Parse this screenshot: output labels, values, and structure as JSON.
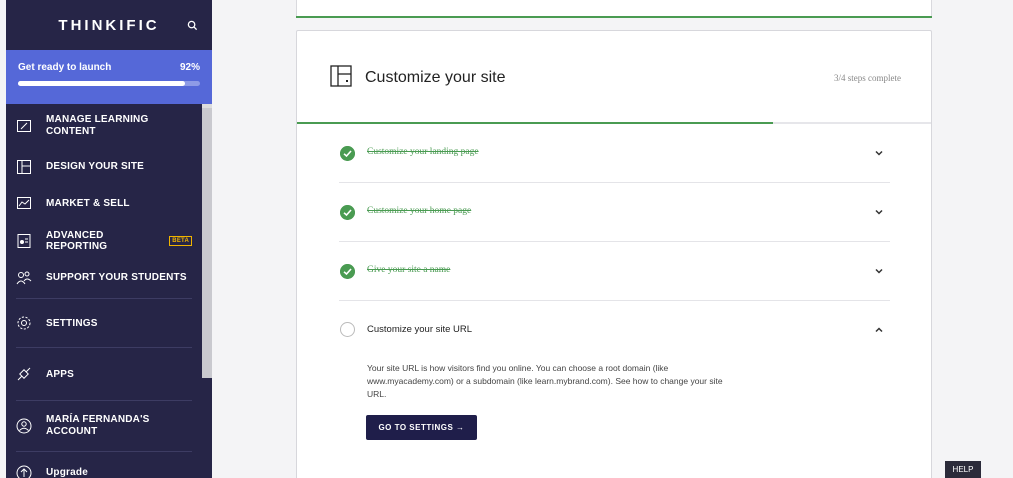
{
  "sidebar": {
    "brand": "THINKIFIC",
    "launch": {
      "label": "Get ready to launch",
      "percent_label": "92%",
      "progress": 0.92
    },
    "items": [
      {
        "line1": "MANAGE LEARNING",
        "line2": "CONTENT"
      },
      {
        "label": "DESIGN YOUR SITE"
      },
      {
        "label": "MARKET & SELL"
      },
      {
        "label": "ADVANCED REPORTING",
        "badge": "BETA"
      },
      {
        "label": "SUPPORT YOUR STUDENTS"
      },
      {
        "label": "SETTINGS"
      },
      {
        "label": "APPS"
      },
      {
        "line1": "MARÍA FERNANDA'S",
        "line2": "ACCOUNT"
      },
      {
        "label": "Upgrade"
      }
    ]
  },
  "card": {
    "title": "Customize your site",
    "steps_complete": "3/4 steps complete",
    "progress": 0.75,
    "steps": [
      {
        "label": "Customize your landing page",
        "done": true
      },
      {
        "label": "Customize your home page",
        "done": true
      },
      {
        "label": "Give your site a name",
        "done": true
      },
      {
        "label": "Customize your site URL",
        "done": false
      }
    ],
    "description": "Your site URL is how visitors find you online. You can choose a root domain (like www.myacademy.com) or a subdomain (like learn.mybrand.com). See how to change your site URL.",
    "button_label": "GO TO SETTINGS →"
  },
  "help_label": "HELP",
  "colors": {
    "sidebar_bg": "#262547",
    "launch_bg": "#5568d8",
    "success": "#4a9b52",
    "button_bg": "#1f1e4a"
  }
}
